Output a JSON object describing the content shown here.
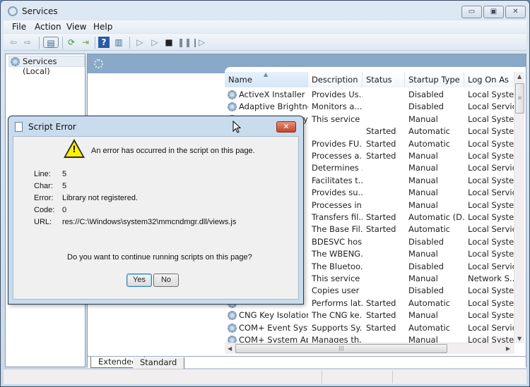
{
  "window": {
    "title": "Services",
    "controls": {
      "minimize": "▭",
      "maximize": "▣",
      "close": "✕"
    }
  },
  "menu": [
    "File",
    "Action",
    "View",
    "Help"
  ],
  "toolbar": {
    "icons": [
      "back-arrow-icon",
      "forward-arrow-icon",
      "show-hide-console-tree-icon",
      "refresh-icon",
      "export-list-icon",
      "help-icon",
      "show-hide-action-pane-icon",
      "start-service-icon",
      "start-service-alt-icon",
      "stop-service-icon",
      "pause-service-icon",
      "restart-service-icon"
    ]
  },
  "tree": {
    "root": "Services (Local)"
  },
  "list": {
    "columns": [
      "Name",
      "Description",
      "Status",
      "Startup Type",
      "Log On As"
    ],
    "rows": [
      {
        "name": "ActiveX Installer (...",
        "desc": "Provides Us...",
        "status": "",
        "startup": "Disabled",
        "logon": "Local Syste..."
      },
      {
        "name": "Adaptive Brightness",
        "desc": "Monitors a...",
        "status": "",
        "startup": "Disabled",
        "logon": "Local Service"
      },
      {
        "name": "Adobe Flash Playe...",
        "desc": "This service ...",
        "status": "",
        "startup": "Manual",
        "logon": "Local Syste..."
      },
      {
        "name": "",
        "desc": "",
        "status": "Started",
        "startup": "Automatic",
        "logon": "Local Syste..."
      },
      {
        "name": "",
        "desc": "Provides FU...",
        "status": "Started",
        "startup": "Automatic",
        "logon": "Local Syste..."
      },
      {
        "name": "",
        "desc": "Processes a...",
        "status": "Started",
        "startup": "Manual",
        "logon": "Local Syste..."
      },
      {
        "name": "",
        "desc": "Determines ...",
        "status": "",
        "startup": "Manual",
        "logon": "Local Service"
      },
      {
        "name": "",
        "desc": "Facilitates t...",
        "status": "",
        "startup": "Manual",
        "logon": "Local Syste..."
      },
      {
        "name": "",
        "desc": "Provides su...",
        "status": "",
        "startup": "Manual",
        "logon": "Local Service"
      },
      {
        "name": "",
        "desc": "Processes in...",
        "status": "",
        "startup": "Manual",
        "logon": "Local Syste..."
      },
      {
        "name": "",
        "desc": "Transfers fil...",
        "status": "Started",
        "startup": "Automatic (D...",
        "logon": "Local Syste..."
      },
      {
        "name": "",
        "desc": "The Base Fil...",
        "status": "Started",
        "startup": "Automatic",
        "logon": "Local Service"
      },
      {
        "name": "",
        "desc": "BDESVC hos...",
        "status": "",
        "startup": "Disabled",
        "logon": "Local Syste..."
      },
      {
        "name": "",
        "desc": "The WBENG...",
        "status": "",
        "startup": "Manual",
        "logon": "Local Syste..."
      },
      {
        "name": "",
        "desc": "The Bluetoo...",
        "status": "",
        "startup": "Disabled",
        "logon": "Local Service"
      },
      {
        "name": "",
        "desc": "This service ...",
        "status": "",
        "startup": "Manual",
        "logon": "Network S..."
      },
      {
        "name": "",
        "desc": "Copies user ...",
        "status": "",
        "startup": "Disabled",
        "logon": "Local Syste..."
      },
      {
        "name": "",
        "desc": "Performs lat...",
        "status": "Started",
        "startup": "Automatic",
        "logon": "Local Syste..."
      },
      {
        "name": "CNG Key Isolation",
        "desc": "The CNG ke...",
        "status": "Started",
        "startup": "Manual",
        "logon": "Local Syste..."
      },
      {
        "name": "COM+ Event Syst...",
        "desc": "Supports Sy...",
        "status": "Started",
        "startup": "Automatic",
        "logon": "Local Service"
      },
      {
        "name": "COM+ System Ap...",
        "desc": "Manages th...",
        "status": "",
        "startup": "Manual",
        "logon": "Local Syste..."
      }
    ]
  },
  "tabs": [
    "Extended",
    "Standard"
  ],
  "dialog": {
    "title": "Script Error",
    "close": "✕",
    "message": "An error has occurred in the script on this page.",
    "fields": [
      {
        "label": "Line:",
        "value": "5"
      },
      {
        "label": "Char:",
        "value": "5"
      },
      {
        "label": "Error:",
        "value": "Library not registered."
      },
      {
        "label": "Code:",
        "value": "0"
      },
      {
        "label": "URL:",
        "value": "res://C:\\Windows\\system32\\mmcndmgr.dll/views.js"
      }
    ],
    "question": "Do you want to continue running scripts on this page?",
    "yes": "Yes",
    "no": "No"
  }
}
